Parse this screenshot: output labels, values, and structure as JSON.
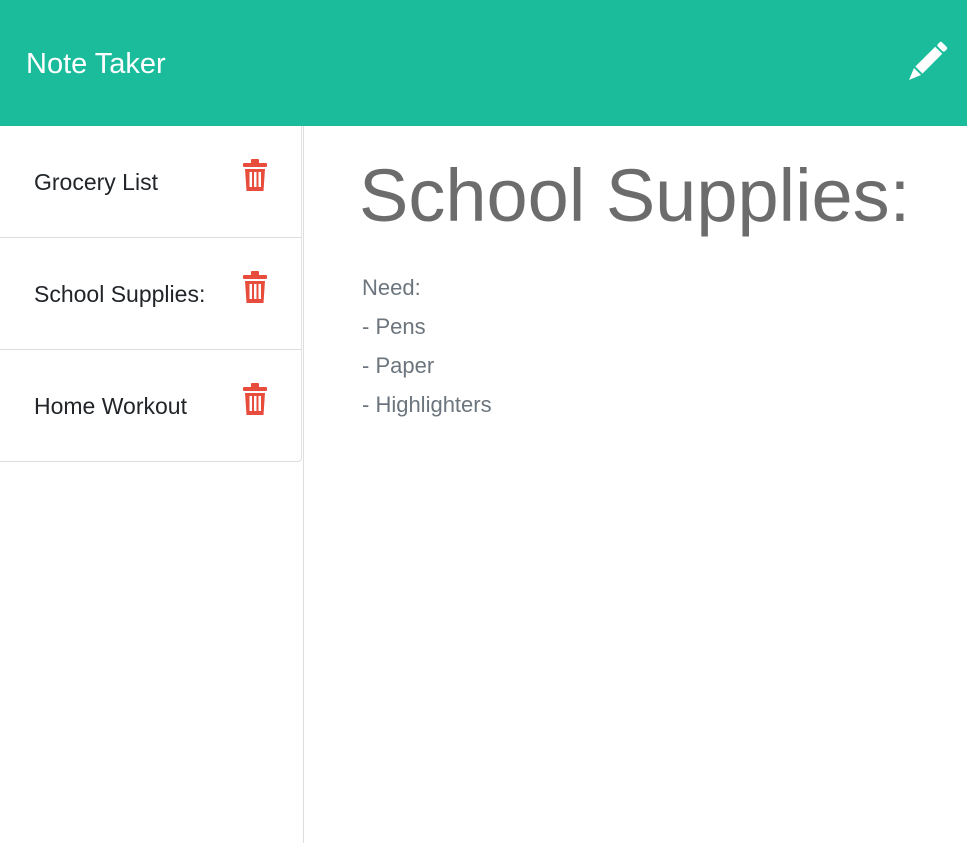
{
  "navbar": {
    "brand": "Note Taker",
    "new_note_icon": "pencil-icon",
    "background_color": "#1abc9c"
  },
  "sidebar": {
    "notes": [
      {
        "title": "Grocery List",
        "delete_icon": "trash-icon"
      },
      {
        "title": "School Supplies:",
        "delete_icon": "trash-icon"
      },
      {
        "title": "Home Workout",
        "delete_icon": "trash-icon"
      }
    ],
    "delete_icon_color": "#e74c3c"
  },
  "active_note": {
    "title": "School Supplies:",
    "body_lines": [
      "Need:",
      "- Pens",
      "- Paper",
      "- Highlighters"
    ]
  }
}
